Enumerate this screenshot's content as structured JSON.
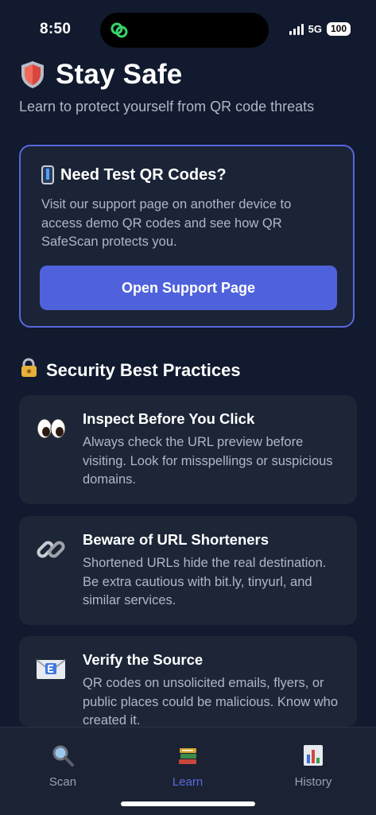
{
  "status": {
    "time": "8:50",
    "network": "5G",
    "battery": "100"
  },
  "header": {
    "title": "Stay Safe",
    "subtitle": "Learn to protect yourself from QR code threats"
  },
  "test_card": {
    "title": "Need Test QR Codes?",
    "description": "Visit our support page on another device to access demo QR codes and see how QR SafeScan protects you.",
    "button_label": "Open Support Page"
  },
  "section": {
    "title": "Security Best Practices"
  },
  "practices": [
    {
      "icon": "eyes-icon",
      "title": "Inspect Before You Click",
      "description": "Always check the URL preview before visiting. Look for misspellings or suspicious domains."
    },
    {
      "icon": "link-icon",
      "title": "Beware of URL Shorteners",
      "description": "Shortened URLs hide the real destination. Be extra cautious with bit.ly, tinyurl, and similar services."
    },
    {
      "icon": "email-icon",
      "title": "Verify the Source",
      "description": "QR codes on unsolicited emails, flyers, or public places could be malicious. Know who created it."
    }
  ],
  "tabs": [
    {
      "label": "Scan",
      "icon": "magnifier-icon",
      "active": false
    },
    {
      "label": "Learn",
      "icon": "books-icon",
      "active": true
    },
    {
      "label": "History",
      "icon": "bar-chart-icon",
      "active": false
    }
  ],
  "colors": {
    "background": "#111a2e",
    "card": "#1c2636",
    "accent": "#4f62dc",
    "card_border": "#5768dc",
    "muted_text": "#aeb7c7"
  }
}
